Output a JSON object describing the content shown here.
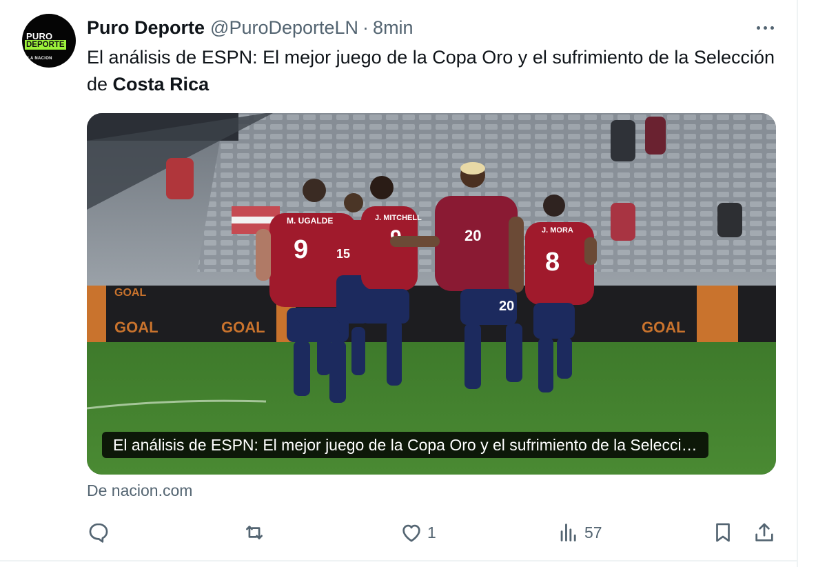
{
  "author": {
    "name": "Puro Deporte",
    "handle": "@PuroDeporteLN",
    "separator": "·",
    "time": "8min",
    "avatar_logo": [
      "PURO",
      "DEPORTE",
      "LA NACION"
    ]
  },
  "tweet": {
    "text_start": "El análisis de ESPN: El mejor juego de la Copa Oro y el sufrimiento de la Selección de ",
    "text_bold": "Costa Rica"
  },
  "card": {
    "caption": "El análisis de ESPN: El mejor juego de la Copa Oro y el sufrimiento de la Selecci…",
    "source": "De nacion.com",
    "image_text": {
      "board": "GOAL",
      "players": [
        {
          "name": "M. UGALDE",
          "number": "9"
        },
        {
          "number": "15"
        },
        {
          "name": "J. MITCHELL",
          "number": "9"
        },
        {
          "number": "20"
        },
        {
          "name": "J. MORA",
          "number": "8"
        }
      ]
    }
  },
  "actions": {
    "reply": {
      "icon": "reply-icon",
      "count": ""
    },
    "retweet": {
      "icon": "retweet-icon",
      "count": ""
    },
    "like": {
      "icon": "heart-icon",
      "count": "1"
    },
    "views": {
      "icon": "views-icon",
      "count": "57"
    },
    "bookmark": {
      "icon": "bookmark-icon"
    },
    "share": {
      "icon": "share-icon"
    }
  },
  "colors": {
    "text": "#0f1419",
    "muted": "#536471",
    "jersey": "#a01a2c",
    "shorts": "#1c2a5e",
    "pitch": "#3f7d2c",
    "logo_green": "#9cf23a"
  }
}
